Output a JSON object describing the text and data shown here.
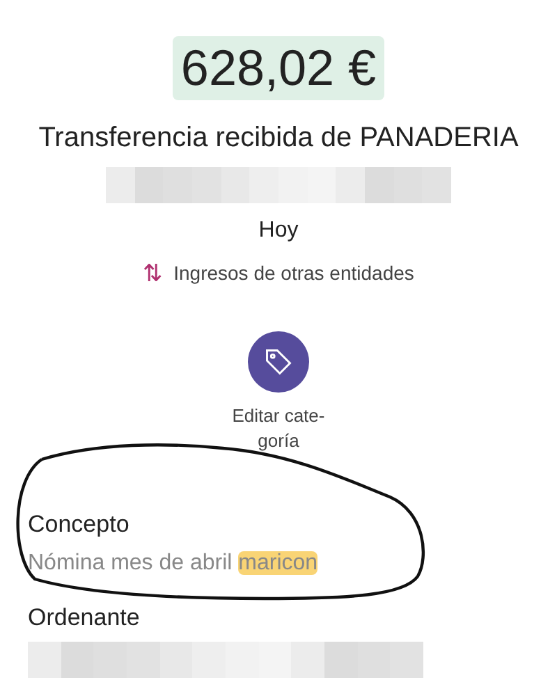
{
  "amount": "628,02 €",
  "title": "Transferencia recibida de PANADERIA",
  "redacted_1": {
    "kind": "redacted"
  },
  "date": "Hoy",
  "category": {
    "icon": "⇅",
    "label": "Ingresos de otras entidades"
  },
  "edit_category": {
    "label": "Editar cate-\ngoría"
  },
  "fields": [
    {
      "label": "Concepto",
      "parts": [
        {
          "text": "Nómina mes de abril ",
          "highlighted": false
        },
        {
          "text": "maricon",
          "highlighted": true
        }
      ]
    },
    {
      "label": "Ordenante",
      "redacted": true
    }
  ],
  "annotation": {
    "kind": "circled"
  }
}
